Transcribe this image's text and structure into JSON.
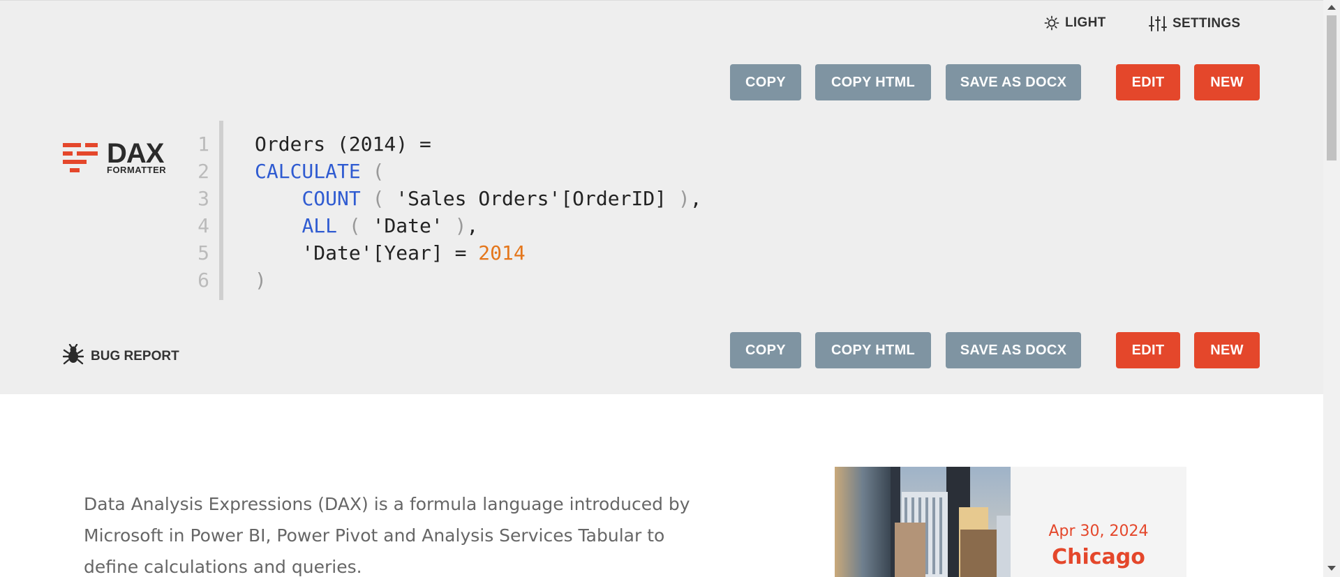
{
  "header": {
    "theme_label": "LIGHT",
    "settings_label": "SETTINGS"
  },
  "toolbar_top": {
    "copy": "COPY",
    "copy_html": "COPY HTML",
    "save_docx": "SAVE AS DOCX",
    "edit": "EDIT",
    "new": "NEW"
  },
  "toolbar_bottom": {
    "copy": "COPY",
    "copy_html": "COPY HTML",
    "save_docx": "SAVE AS DOCX",
    "edit": "EDIT",
    "new": "NEW"
  },
  "logo": {
    "word": "DAX",
    "sub": "FORMATTER"
  },
  "code": {
    "line_numbers": [
      "1",
      "2",
      "3",
      "4",
      "5",
      "6"
    ],
    "lines": [
      [
        {
          "t": "Orders (2014) =",
          "c": "plain"
        }
      ],
      [
        {
          "t": "CALCULATE",
          "c": "kw"
        },
        {
          "t": " ",
          "c": "plain"
        },
        {
          "t": "(",
          "c": "paren"
        }
      ],
      [
        {
          "t": "    ",
          "c": "plain"
        },
        {
          "t": "COUNT",
          "c": "kw"
        },
        {
          "t": " ",
          "c": "plain"
        },
        {
          "t": "(",
          "c": "paren"
        },
        {
          "t": " 'Sales Orders'[OrderID] ",
          "c": "plain"
        },
        {
          "t": ")",
          "c": "paren"
        },
        {
          "t": ",",
          "c": "plain"
        }
      ],
      [
        {
          "t": "    ",
          "c": "plain"
        },
        {
          "t": "ALL",
          "c": "kw"
        },
        {
          "t": " ",
          "c": "plain"
        },
        {
          "t": "(",
          "c": "paren"
        },
        {
          "t": " 'Date' ",
          "c": "plain"
        },
        {
          "t": ")",
          "c": "paren"
        },
        {
          "t": ",",
          "c": "plain"
        }
      ],
      [
        {
          "t": "    'Date'[Year] = ",
          "c": "plain"
        },
        {
          "t": "2014",
          "c": "num"
        }
      ],
      [
        {
          "t": ")",
          "c": "paren"
        }
      ]
    ]
  },
  "bug_report": "BUG REPORT",
  "description": "Data Analysis Expressions (DAX) is a formula language introduced by Microsoft in Power BI, Power Pivot and Analysis Services Tabular to define calculations and queries.",
  "event": {
    "date": "Apr 30, 2024",
    "city": "Chicago"
  },
  "colors": {
    "accent": "#e4472b",
    "button_gray": "#7f94a2",
    "keyword": "#2f5bd1",
    "number": "#e4761b"
  }
}
